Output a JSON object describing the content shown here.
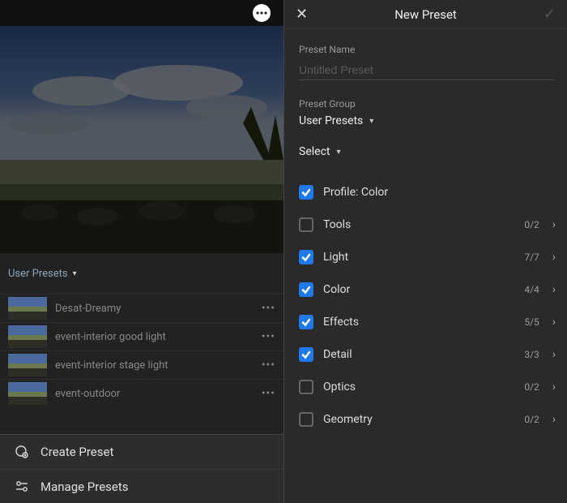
{
  "left": {
    "preset_group_label": "User Presets",
    "presets": [
      {
        "name": "Desat-Dreamy"
      },
      {
        "name": "event-interior good light"
      },
      {
        "name": "event-interior stage light"
      },
      {
        "name": "event-outdoor"
      }
    ],
    "popup": {
      "create": "Create Preset",
      "manage": "Manage Presets"
    }
  },
  "right": {
    "title": "New Preset",
    "name_label": "Preset Name",
    "name_placeholder": "Untitled Preset",
    "group_label": "Preset Group",
    "group_value": "User Presets",
    "select_label": "Select",
    "settings": [
      {
        "label": "Profile: Color",
        "checked": true,
        "count": "",
        "disclose": false
      },
      {
        "label": "Tools",
        "checked": false,
        "count": "0/2",
        "disclose": true
      },
      {
        "label": "Light",
        "checked": true,
        "count": "7/7",
        "disclose": true
      },
      {
        "label": "Color",
        "checked": true,
        "count": "4/4",
        "disclose": true
      },
      {
        "label": "Effects",
        "checked": true,
        "count": "5/5",
        "disclose": true
      },
      {
        "label": "Detail",
        "checked": true,
        "count": "3/3",
        "disclose": true
      },
      {
        "label": "Optics",
        "checked": false,
        "count": "0/2",
        "disclose": true
      },
      {
        "label": "Geometry",
        "checked": false,
        "count": "0/2",
        "disclose": true
      }
    ]
  }
}
